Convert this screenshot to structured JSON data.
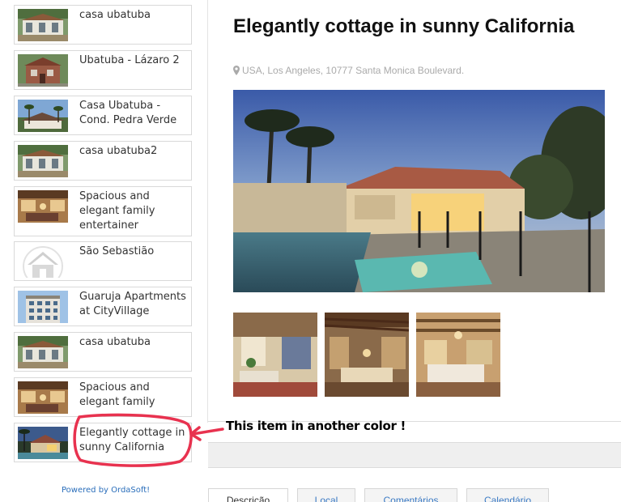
{
  "sidebar": {
    "items": [
      {
        "label": "casa ubatuba",
        "thumb": "porch-house"
      },
      {
        "label": "Ubatuba - Lázaro 2",
        "thumb": "brick-house"
      },
      {
        "label": "Casa Ubatuba - Cond. Pedra Verde",
        "thumb": "roof-palms"
      },
      {
        "label": "casa ubatuba2",
        "thumb": "porch-house"
      },
      {
        "label": "Spacious and elegant family entertainer",
        "thumb": "interior-room"
      },
      {
        "label": "São Sebastião",
        "thumb": "house-placeholder-icon"
      },
      {
        "label": "Guaruja Apartments at CityVillage",
        "thumb": "apartment-building"
      },
      {
        "label": "casa ubatuba",
        "thumb": "porch-house"
      },
      {
        "label": "Spacious and elegant family",
        "thumb": "interior-room"
      },
      {
        "label": "Elegantly cottage in sunny California",
        "thumb": "evening-house"
      }
    ],
    "powered_by": "Powered by OrdaSoft!"
  },
  "property": {
    "title": "Elegantly cottage in sunny California",
    "address": "USA, Los Angeles, 10777 Santa Monica Boulevard.",
    "photo": "pool-house-dusk",
    "gallery": [
      "living-room-fireplace",
      "covered-patio",
      "bedroom-beams"
    ]
  },
  "tabs": [
    "Descrição",
    "Local",
    "Comentários",
    "Calendário"
  ],
  "active_tab": "Descrição",
  "annotation": {
    "text": "This item in another color !",
    "color": "#e8324f"
  },
  "colors": {
    "link": "#2a6ebb",
    "address": "#aaaaaa",
    "highlight": "#e8324f"
  }
}
